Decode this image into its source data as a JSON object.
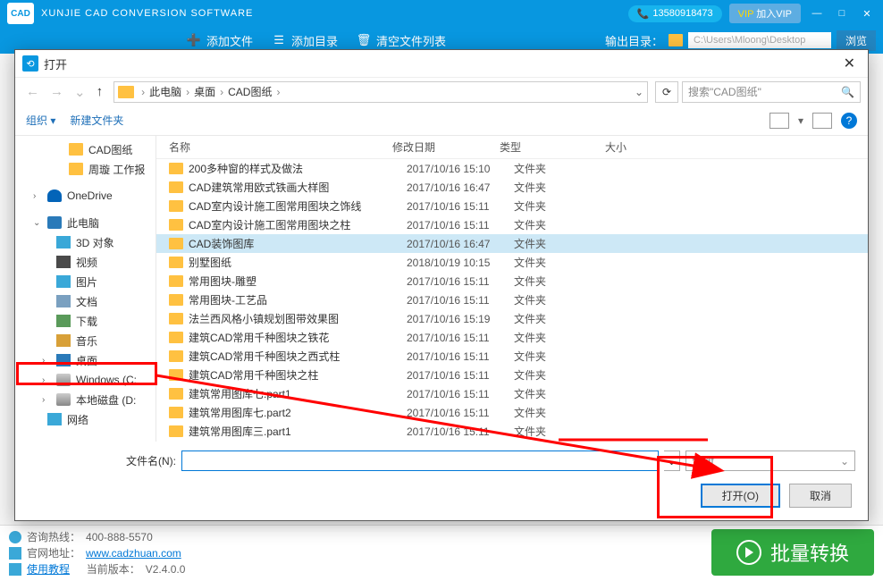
{
  "app": {
    "title": "XUNJIE CAD CONVERSION SOFTWARE",
    "phone": "13580918473",
    "vip_label": "加入VIP",
    "toolbar": {
      "add_file": "添加文件",
      "add_dir": "添加目录",
      "clear": "清空文件列表",
      "output_label": "输出目录：",
      "output_path": "C:\\Users\\Mloong\\Desktop",
      "browse": "浏览"
    }
  },
  "dialog": {
    "title": "打开",
    "breadcrumb": [
      "此电脑",
      "桌面",
      "CAD图纸"
    ],
    "search_placeholder": "搜索\"CAD图纸\"",
    "organize": "组织",
    "new_folder": "新建文件夹",
    "columns": {
      "name": "名称",
      "date": "修改日期",
      "type": "类型",
      "size": "大小"
    },
    "sidebar": [
      {
        "label": "CAD图纸",
        "icon": "folder",
        "lvl": 2
      },
      {
        "label": "周璇 工作报",
        "icon": "folder",
        "lvl": 2
      },
      {
        "label": "OneDrive",
        "icon": "onedrive",
        "lvl": 0,
        "exp": "›"
      },
      {
        "label": "此电脑",
        "icon": "pc",
        "lvl": 0,
        "exp": "⌄"
      },
      {
        "label": "3D 对象",
        "icon": "obj3d",
        "lvl": 1
      },
      {
        "label": "视频",
        "icon": "video",
        "lvl": 1
      },
      {
        "label": "图片",
        "icon": "pic",
        "lvl": 1
      },
      {
        "label": "文档",
        "icon": "doc",
        "lvl": 1
      },
      {
        "label": "下载",
        "icon": "download",
        "lvl": 1
      },
      {
        "label": "音乐",
        "icon": "music",
        "lvl": 1
      },
      {
        "label": "桌面",
        "icon": "desktop",
        "lvl": 1,
        "exp": "›"
      },
      {
        "label": "Windows (C:",
        "icon": "drive",
        "lvl": 1,
        "exp": "›"
      },
      {
        "label": "本地磁盘 (D:",
        "icon": "drive",
        "lvl": 1,
        "exp": "›"
      },
      {
        "label": "网络",
        "icon": "network",
        "lvl": 0
      }
    ],
    "files": [
      {
        "name": "200多种窗的样式及做法",
        "date": "2017/10/16 15:10",
        "type": "文件夹"
      },
      {
        "name": "CAD建筑常用欧式铁画大样图",
        "date": "2017/10/16 16:47",
        "type": "文件夹"
      },
      {
        "name": "CAD室内设计施工图常用图块之饰线",
        "date": "2017/10/16 15:11",
        "type": "文件夹"
      },
      {
        "name": "CAD室内设计施工图常用图块之柱",
        "date": "2017/10/16 15:11",
        "type": "文件夹"
      },
      {
        "name": "CAD装饰图库",
        "date": "2017/10/16 16:47",
        "type": "文件夹",
        "selected": true
      },
      {
        "name": "别墅图纸",
        "date": "2018/10/19 10:15",
        "type": "文件夹"
      },
      {
        "name": "常用图块-雕塑",
        "date": "2017/10/16 15:11",
        "type": "文件夹"
      },
      {
        "name": "常用图块-工艺品",
        "date": "2017/10/16 15:11",
        "type": "文件夹"
      },
      {
        "name": "法兰西风格小镇规划图带效果图",
        "date": "2017/10/16 15:19",
        "type": "文件夹"
      },
      {
        "name": "建筑CAD常用千种图块之铁花",
        "date": "2017/10/16 15:11",
        "type": "文件夹"
      },
      {
        "name": "建筑CAD常用千种图块之西式柱",
        "date": "2017/10/16 15:11",
        "type": "文件夹"
      },
      {
        "name": "建筑CAD常用千种图块之柱",
        "date": "2017/10/16 15:11",
        "type": "文件夹"
      },
      {
        "name": "建筑常用图库七.part1",
        "date": "2017/10/16 15:11",
        "type": "文件夹"
      },
      {
        "name": "建筑常用图库七.part2",
        "date": "2017/10/16 15:11",
        "type": "文件夹"
      },
      {
        "name": "建筑常用图库三.part1",
        "date": "2017/10/16 15:11",
        "type": "文件夹"
      }
    ],
    "filename_label": "文件名(N):",
    "filetype": "*.pdf",
    "open_btn": "打开(O)",
    "cancel_btn": "取消"
  },
  "footer": {
    "hotline_label": "咨询热线：",
    "hotline": "400-888-5570",
    "site_label": "官网地址：",
    "site": "www.cadzhuan.com",
    "tutorial": "使用教程",
    "version_label": "当前版本：",
    "version": "V2.4.0.0"
  },
  "batch_button": "批量转换"
}
